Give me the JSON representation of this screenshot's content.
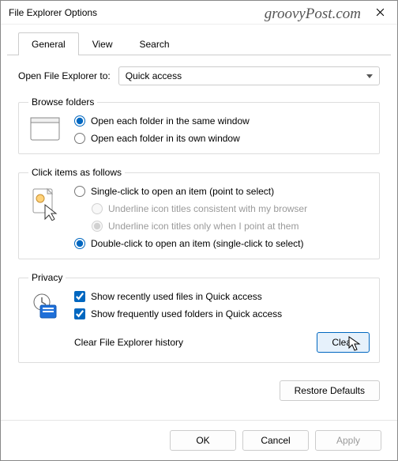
{
  "window": {
    "title": "File Explorer Options"
  },
  "watermark": "groovyPost.com",
  "tabs": {
    "general": "General",
    "view": "View",
    "search": "Search"
  },
  "open_to": {
    "label": "Open File Explorer to:",
    "value": "Quick access"
  },
  "browse": {
    "legend": "Browse folders",
    "same": "Open each folder in the same window",
    "own": "Open each folder in its own window"
  },
  "click": {
    "legend": "Click items as follows",
    "single": "Single-click to open an item (point to select)",
    "u_browser": "Underline icon titles consistent with my browser",
    "u_point": "Underline icon titles only when I point at them",
    "double": "Double-click to open an item (single-click to select)"
  },
  "privacy": {
    "legend": "Privacy",
    "recent_files": "Show recently used files in Quick access",
    "freq_folders": "Show frequently used folders in Quick access",
    "clear_label": "Clear File Explorer history",
    "clear_btn": "Clear"
  },
  "buttons": {
    "restore": "Restore Defaults",
    "ok": "OK",
    "cancel": "Cancel",
    "apply": "Apply"
  }
}
